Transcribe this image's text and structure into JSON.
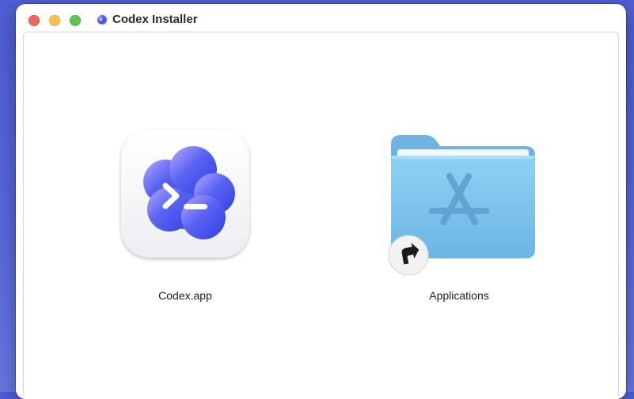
{
  "window": {
    "title": "Codex Installer",
    "controls": [
      "close",
      "minimize",
      "zoom"
    ]
  },
  "items": [
    {
      "label": "Codex.app",
      "icon": "codex-app-icon"
    },
    {
      "label": "Applications",
      "icon": "applications-folder-icon",
      "badge": "alias-arrow-icon"
    }
  ],
  "colors": {
    "desktop": "#5563da",
    "close": "#ed6a5e",
    "minimize": "#f5bf4f",
    "zoom": "#61c554",
    "folder": "#7cc6ef"
  }
}
